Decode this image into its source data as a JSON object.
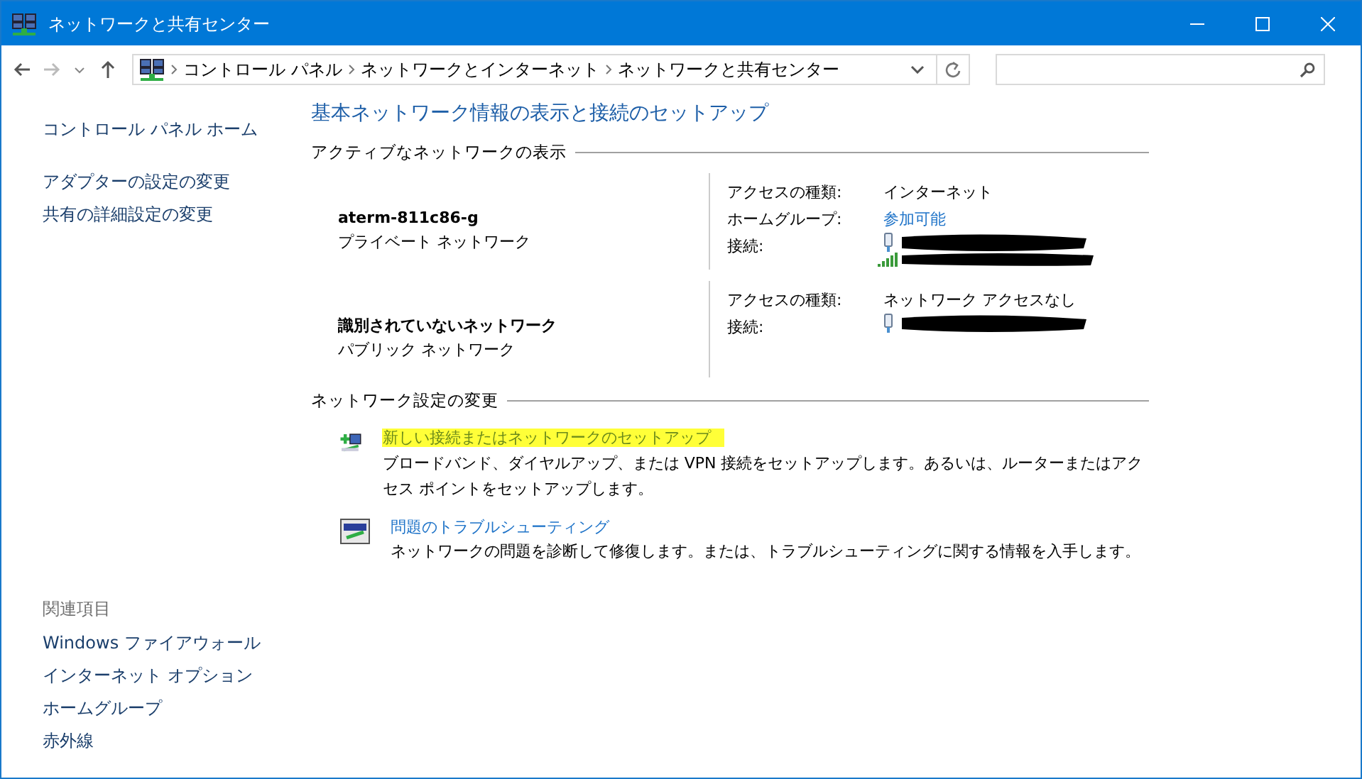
{
  "window": {
    "title": "ネットワークと共有センター"
  },
  "address_bar": {
    "breadcrumbs": [
      "コントロール パネル",
      "ネットワークとインターネット",
      "ネットワークと共有センター"
    ]
  },
  "sidebar": {
    "items": [
      "コントロール パネル ホーム",
      "アダプターの設定の変更",
      "共有の詳細設定の変更"
    ],
    "related_heading": "関連項目",
    "related_items": [
      "Windows ファイアウォール",
      "インターネット オプション",
      "ホームグループ",
      "赤外線"
    ]
  },
  "main": {
    "heading": "基本ネットワーク情報の表示と接続のセットアップ",
    "active_section": "アクティブなネットワークの表示",
    "networks": [
      {
        "name": "aterm-811c86-g",
        "type": "プライベート ネットワーク",
        "access_label": "アクセスの種類:",
        "access": "インターネット",
        "homegroup_label": "ホームグループ:",
        "homegroup": "参加可能",
        "connection_label": "接続:",
        "wifi": true
      },
      {
        "name": "識別されていないネットワーク",
        "type": "パブリック ネットワーク",
        "access_label": "アクセスの種類:",
        "access": "ネットワーク アクセスなし",
        "connection_label": "接続:",
        "wifi": false
      }
    ],
    "settings_section": "ネットワーク設定の変更",
    "tasks": [
      {
        "kind": "new-connection",
        "link": "新しい接続またはネットワークのセットアップ",
        "highlighted": true,
        "description": "ブロードバンド、ダイヤルアップ、または VPN 接続をセットアップします。あるいは、ルーターまたはアクセス ポイントをセットアップします。"
      },
      {
        "kind": "troubleshoot",
        "link": "問題のトラブルシューティング",
        "highlighted": false,
        "description": "ネットワークの問題を診断して修復します。または、トラブルシューティングに関する情報を入手します。"
      }
    ]
  }
}
